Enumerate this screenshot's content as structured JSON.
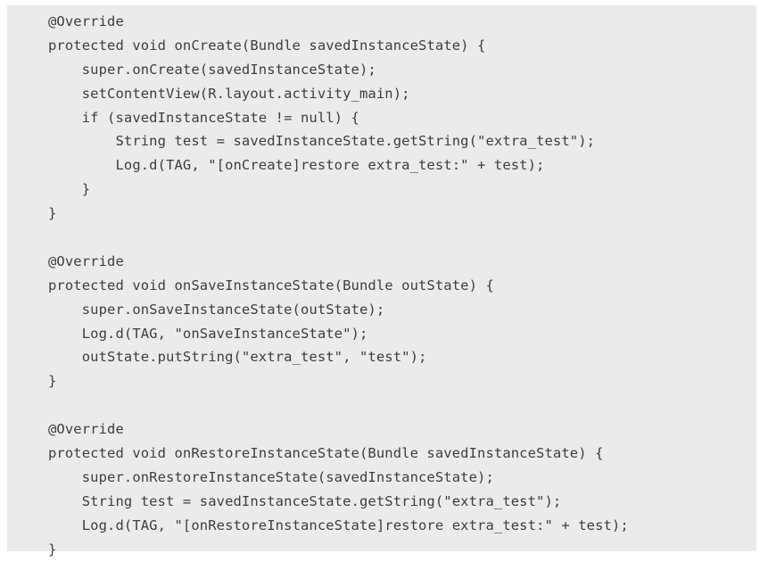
{
  "code": {
    "lines": [
      "@Override",
      "protected void onCreate(Bundle savedInstanceState) {",
      "    super.onCreate(savedInstanceState);",
      "    setContentView(R.layout.activity_main);",
      "    if (savedInstanceState != null) {",
      "        String test = savedInstanceState.getString(\"extra_test\");",
      "        Log.d(TAG, \"[onCreate]restore extra_test:\" + test);",
      "    }",
      "}",
      "",
      "@Override",
      "protected void onSaveInstanceState(Bundle outState) {",
      "    super.onSaveInstanceState(outState);",
      "    Log.d(TAG, \"onSaveInstanceState\");",
      "    outState.putString(\"extra_test\", \"test\");",
      "}",
      "",
      "@Override",
      "protected void onRestoreInstanceState(Bundle savedInstanceState) {",
      "    super.onRestoreInstanceState(savedInstanceState);",
      "    String test = savedInstanceState.getString(\"extra_test\");",
      "    Log.d(TAG, \"[onRestoreInstanceState]restore extra_test:\" + test);",
      "}"
    ]
  }
}
